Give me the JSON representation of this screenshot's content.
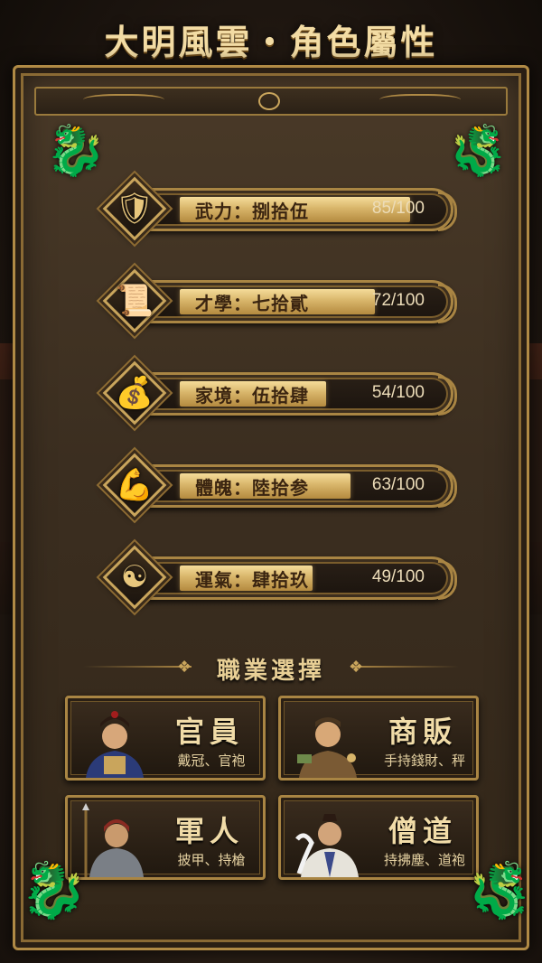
{
  "title": "大明風雲・角色屬性",
  "stats": [
    {
      "label": "武力：捌拾伍",
      "value": "85/100",
      "percent": 85,
      "icon": "sword-shield-icon"
    },
    {
      "label": "才學：七拾貳",
      "value": "72/100",
      "percent": 72,
      "icon": "scroll-brush-icon"
    },
    {
      "label": "家境：伍拾肆",
      "value": "54/100",
      "percent": 54,
      "icon": "treasure-chest-icon"
    },
    {
      "label": "體魄：陸拾参",
      "value": "63/100",
      "percent": 63,
      "icon": "muscle-figure-icon"
    },
    {
      "label": "運氣：肆拾玖",
      "value": "49/100",
      "percent": 49,
      "icon": "yin-yang-bagua-icon"
    }
  ],
  "career_section": {
    "title": "職業選擇"
  },
  "careers": [
    {
      "name": "官員",
      "desc": "戴冠、官袍"
    },
    {
      "name": "商販",
      "desc": "手持錢財、秤"
    },
    {
      "name": "軍人",
      "desc": "披甲、持槍"
    },
    {
      "name": "僧道",
      "desc": "持拂塵、道袍"
    }
  ],
  "colors": {
    "gold": "#c9a55c",
    "bar_fill": "#d8b56a",
    "frame": "#3b2e20"
  }
}
